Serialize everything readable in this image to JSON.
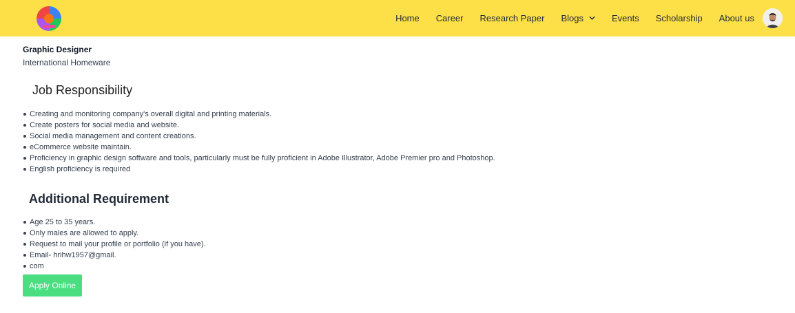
{
  "nav": {
    "items": [
      {
        "label": "Home"
      },
      {
        "label": "Career"
      },
      {
        "label": "Research Paper"
      },
      {
        "label": "Blogs"
      },
      {
        "label": "Events"
      },
      {
        "label": "Scholarship"
      },
      {
        "label": "About us"
      }
    ],
    "bar_color": "#fde047"
  },
  "job": {
    "title": "Graphic Designer",
    "company": "International Homeware"
  },
  "responsibility": {
    "heading": "Job Responsibility",
    "items": [
      "Creating and monitoring company's overall digital and printing materials.",
      "Create posters for social media and website.",
      "Social media management and content creations.",
      "eCommerce website maintain.",
      "Proficiency in graphic design software and tools, particularly must be fully proficient in Adobe Illustrator, Adobe Premier pro and Photoshop.",
      "English proficiency is required"
    ]
  },
  "requirement": {
    "heading": "Additional Requirement",
    "items": [
      "Age 25 to 35 years.",
      "Only males are allowed to apply.",
      "Request to mail your profile or portfolio (if you have).",
      "Email- hrihw1957@gmail.",
      "com"
    ]
  },
  "apply": {
    "label": "Apply Online",
    "color": "#4ade80"
  }
}
